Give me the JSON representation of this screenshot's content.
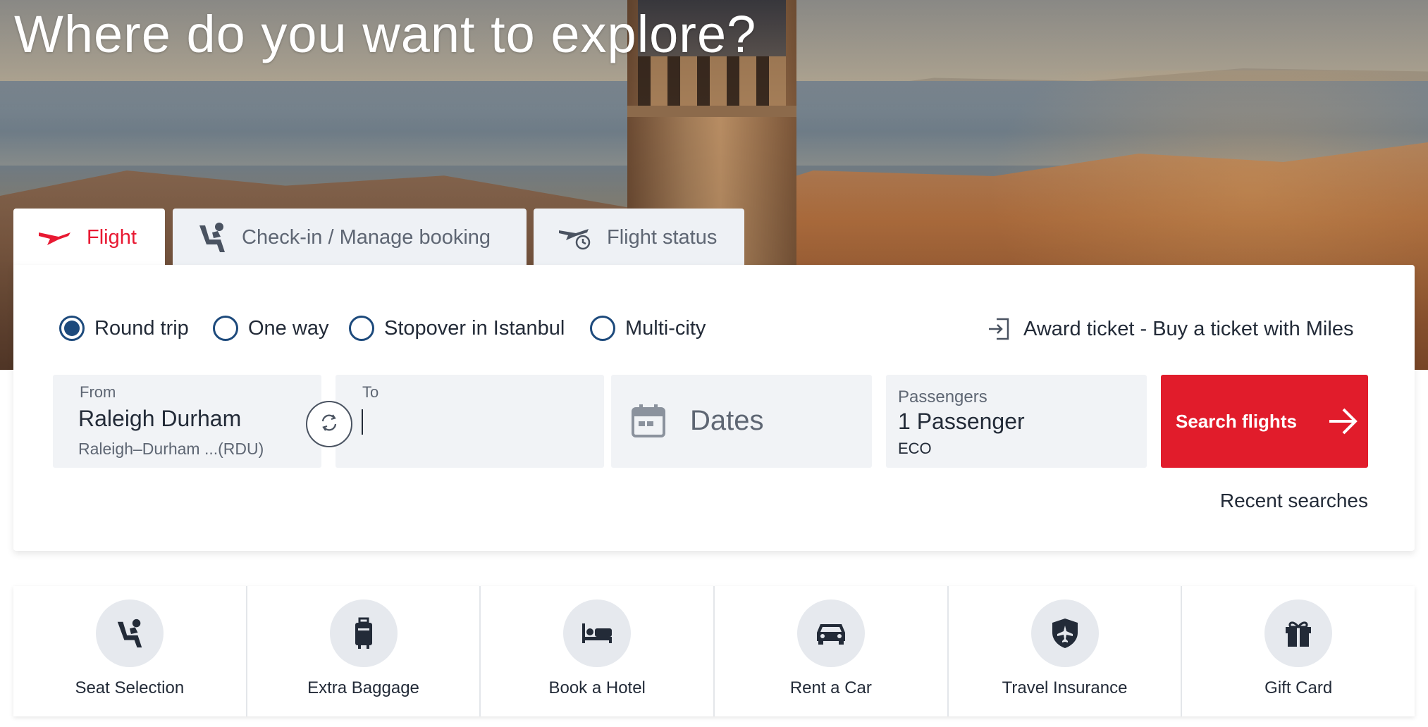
{
  "hero": {
    "title": "Where do you want to explore?"
  },
  "tabs": [
    {
      "label": "Flight",
      "icon": "plane-icon",
      "active": true
    },
    {
      "label": "Check-in / Manage booking",
      "icon": "seat-icon",
      "active": false
    },
    {
      "label": "Flight status",
      "icon": "plane-clock-icon",
      "active": false
    }
  ],
  "trip_types": [
    {
      "label": "Round trip",
      "selected": true
    },
    {
      "label": "One way",
      "selected": false
    },
    {
      "label": "Stopover in Istanbul",
      "selected": false
    },
    {
      "label": "Multi-city",
      "selected": false
    }
  ],
  "award": {
    "label": "Award ticket - Buy a ticket with Miles",
    "icon": "sign-in-icon"
  },
  "search": {
    "from_label": "From",
    "from_city": "Raleigh Durham",
    "from_airport": "Raleigh–Durham ...(RDU)",
    "to_label": "To",
    "to_value": "",
    "dates_placeholder": "Dates",
    "passengers_label": "Passengers",
    "passengers_value": "1  Passenger",
    "cabin_class": "ECO",
    "button_label": "Search flights",
    "recent_searches": "Recent searches"
  },
  "services": [
    {
      "label": "Seat Selection",
      "icon": "seat-icon"
    },
    {
      "label": "Extra Baggage",
      "icon": "suitcase-icon"
    },
    {
      "label": "Book a Hotel",
      "icon": "bed-icon"
    },
    {
      "label": "Rent a Car",
      "icon": "car-icon"
    },
    {
      "label": "Travel Insurance",
      "icon": "shield-plane-icon"
    },
    {
      "label": "Gift Card",
      "icon": "gift-icon"
    }
  ],
  "colors": {
    "brand_red": "#e81932",
    "radio_blue": "#1d4a7c",
    "field_bg": "#f1f3f6",
    "text": "#232b38"
  }
}
